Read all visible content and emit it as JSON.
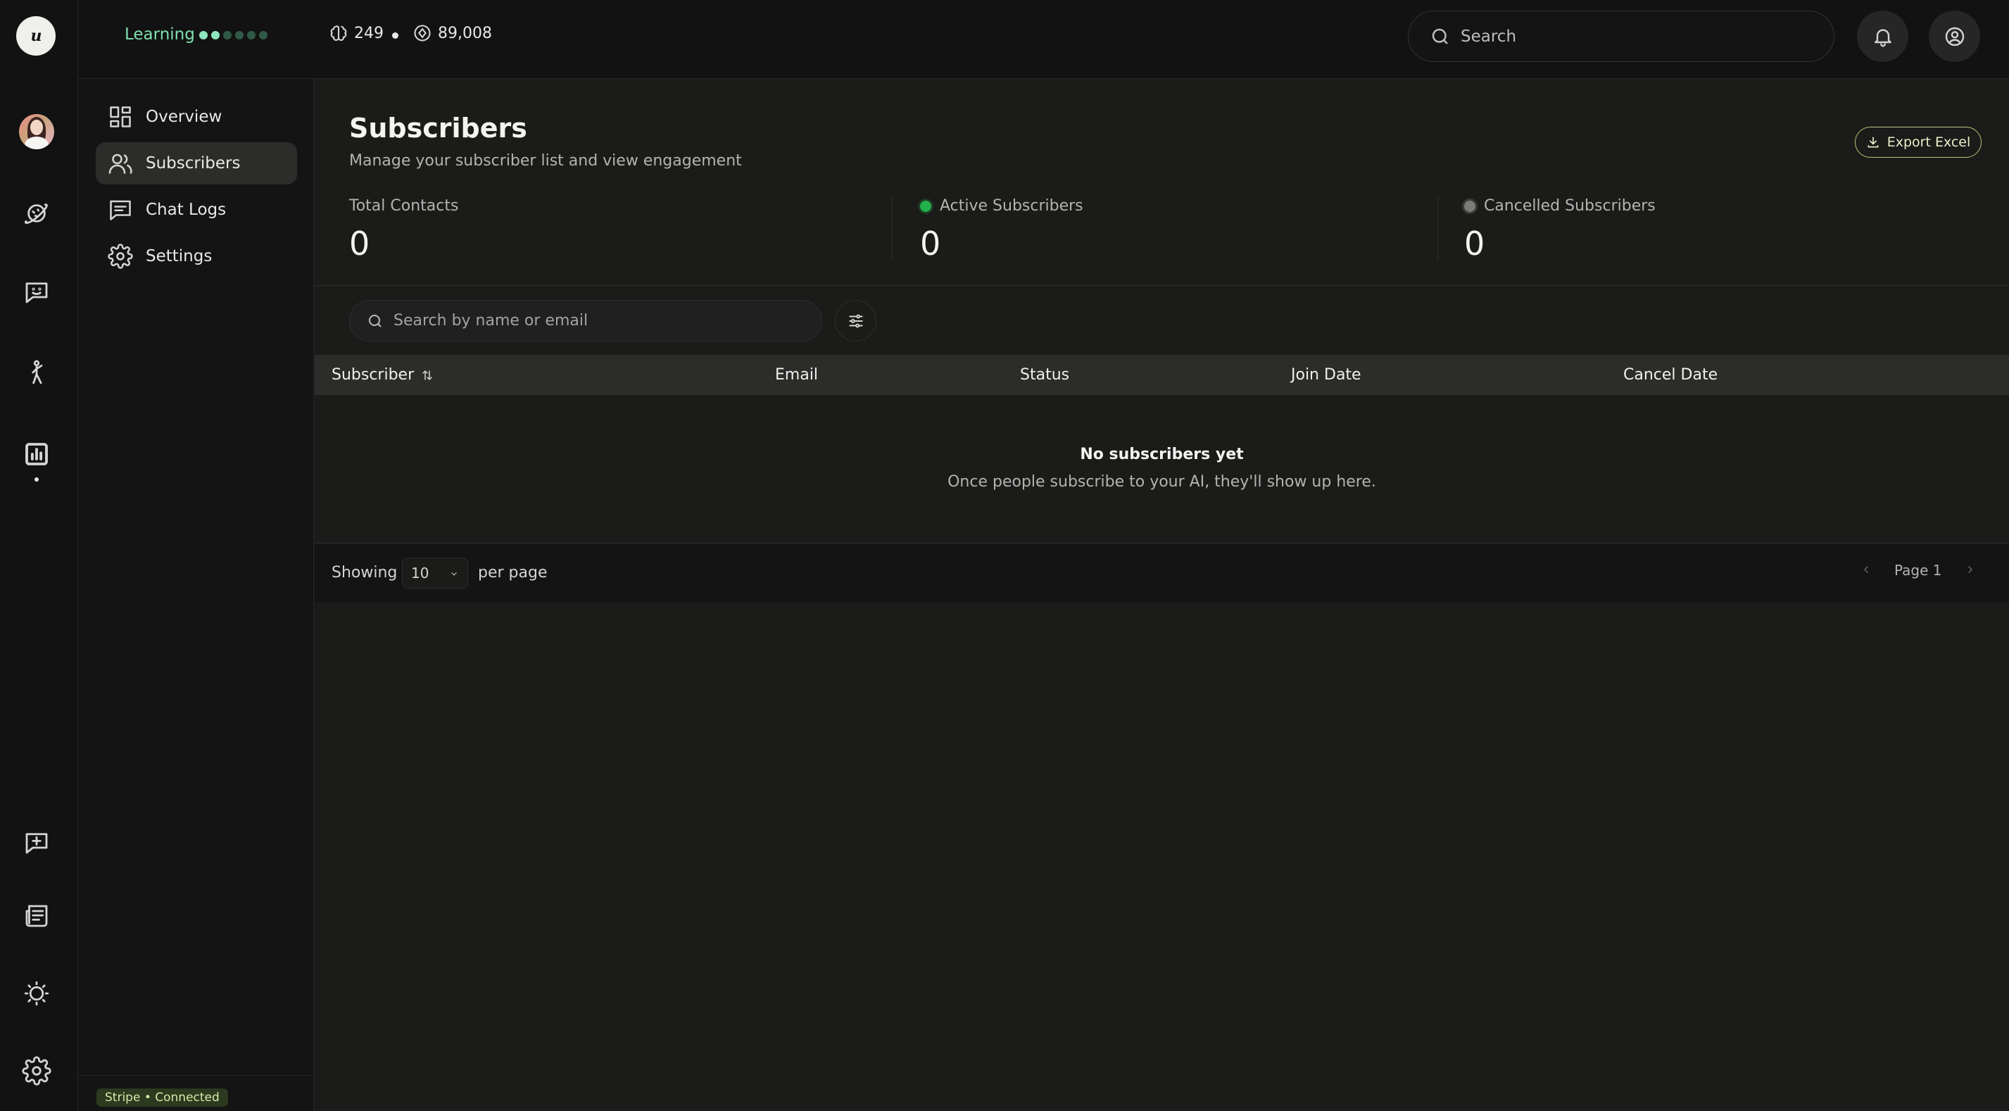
{
  "app": {
    "logo_text": "u"
  },
  "rail": {
    "items": [
      {
        "icon": "avatar"
      },
      {
        "icon": "planet-icon"
      },
      {
        "icon": "smiley-chat-icon"
      },
      {
        "icon": "figure-icon"
      },
      {
        "icon": "analytics-icon",
        "active": true
      },
      {
        "icon": "add-chat-icon"
      },
      {
        "icon": "newspaper-icon"
      },
      {
        "icon": "sun-icon"
      },
      {
        "icon": "gear-icon"
      }
    ]
  },
  "topbar": {
    "level_label": "Learning",
    "level_progress": {
      "filled": 2,
      "total": 6
    },
    "stat_a": "249",
    "stat_b": "89,008",
    "search_placeholder": "Search"
  },
  "subnav": {
    "items": [
      {
        "label": "Overview",
        "icon": "grid-icon"
      },
      {
        "label": "Subscribers",
        "icon": "users-icon",
        "active": true
      },
      {
        "label": "Chat Logs",
        "icon": "message-icon"
      },
      {
        "label": "Settings",
        "icon": "gear-icon"
      }
    ],
    "stripe_status": "Stripe • Connected"
  },
  "page": {
    "title": "Subscribers",
    "subtitle": "Manage your subscriber list and view engagement",
    "export_label": "Export Excel"
  },
  "metrics": [
    {
      "label": "Total Contacts",
      "value": "0"
    },
    {
      "label": "Active Subscribers",
      "value": "0",
      "dot_color": "#22b14c"
    },
    {
      "label": "Cancelled Subscribers",
      "value": "0",
      "dot_color": "#7a7a78"
    }
  ],
  "list": {
    "search_placeholder": "Search by name or email",
    "columns": [
      "Subscriber",
      "Email",
      "Status",
      "Join Date",
      "Cancel Date"
    ],
    "empty_title": "No subscribers yet",
    "empty_subtitle": "Once people subscribe to your AI, they'll show up here."
  },
  "pagination": {
    "showing_label": "Showing",
    "per_page_value": "10",
    "per_page_label": "per page",
    "page_label": "Page 1"
  },
  "colors": {
    "accent_green": "#7fe0b0",
    "active_dot": "#22b14c",
    "cancelled_dot": "#7a7a78",
    "export_border": "#b6c77a"
  }
}
